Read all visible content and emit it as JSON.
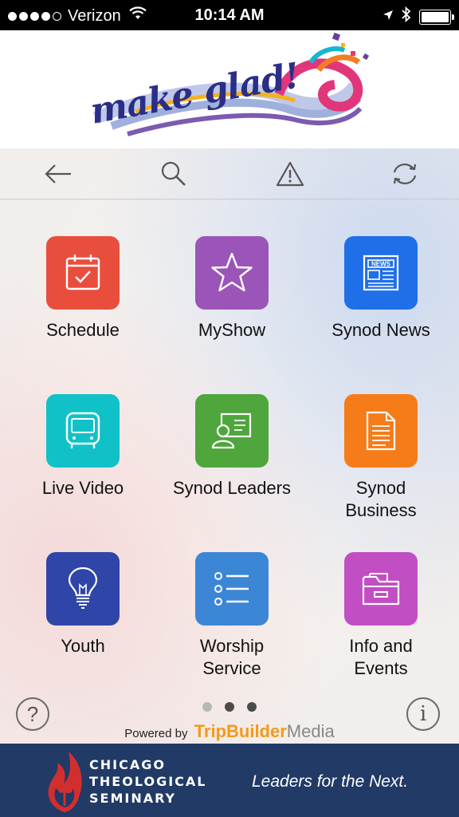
{
  "status_bar": {
    "carrier": "Verizon",
    "time": "10:14 AM",
    "signal_bars": 4,
    "signal_total": 5,
    "battery_level": 1.0
  },
  "header": {
    "logo_text": "make glad!"
  },
  "toolbar": {
    "icons": [
      "back-arrow-icon",
      "search-icon",
      "alert-icon",
      "refresh-icon"
    ]
  },
  "tiles": [
    {
      "label": "Schedule",
      "color": "#e94e3c",
      "icon": "calendar-check-icon"
    },
    {
      "label": "MyShow",
      "color": "#9b55b8",
      "icon": "star-icon"
    },
    {
      "label": "Synod News",
      "color": "#1f6fe8",
      "icon": "newspaper-icon"
    },
    {
      "label": "Live Video",
      "color": "#10c2c8",
      "icon": "video-screen-icon"
    },
    {
      "label": "Synod Leaders",
      "color": "#4fa63c",
      "icon": "id-card-icon"
    },
    {
      "label": "Synod Business",
      "label_line1": "Synod",
      "label_line2": "Business",
      "color": "#f57c18",
      "icon": "document-icon"
    },
    {
      "label": "Youth",
      "color": "#2f45a8",
      "icon": "lightbulb-icon"
    },
    {
      "label": "Worship Service",
      "label_line1": "Worship",
      "label_line2": "Service",
      "color": "#3c86d6",
      "icon": "list-icon"
    },
    {
      "label": "Info and Events",
      "label_line1": "Info and",
      "label_line2": "Events",
      "color": "#c24ec4",
      "icon": "folder-icon"
    }
  ],
  "pager": {
    "pages": 3,
    "current": 2
  },
  "help_label": "?",
  "info_label": "i",
  "powered_by": {
    "prefix": "Powered by",
    "brand_bold": "TripBuilder",
    "brand_light": "Media"
  },
  "footer": {
    "line1": "CHICAGO",
    "line2": "THEOLOGICAL",
    "line3": "SEMINARY",
    "tagline": "Leaders for the Next."
  }
}
